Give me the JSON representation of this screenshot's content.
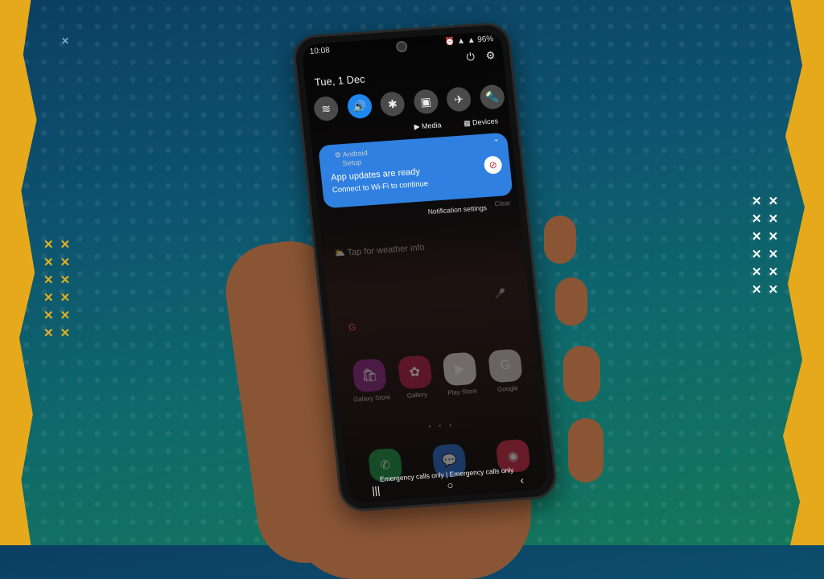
{
  "status_bar": {
    "time": "10:08",
    "icons": "⏰ ▲ ▲",
    "battery": "96%"
  },
  "header": {
    "date": "Tue, 1 Dec",
    "power_icon": "power-icon",
    "settings_icon": "gear-icon"
  },
  "quick_tiles": [
    {
      "name": "wifi",
      "icon": "wifi-icon",
      "glyph": "≋",
      "active": false
    },
    {
      "name": "sound",
      "icon": "volume-icon",
      "glyph": "🔊",
      "active": true
    },
    {
      "name": "bluetooth",
      "icon": "bluetooth-icon",
      "glyph": "✱",
      "active": false
    },
    {
      "name": "portrait",
      "icon": "rotation-lock-icon",
      "glyph": "▣",
      "active": false
    },
    {
      "name": "airplane",
      "icon": "airplane-icon",
      "glyph": "✈",
      "active": false
    },
    {
      "name": "flashlight",
      "icon": "flashlight-icon",
      "glyph": "🔦",
      "active": false
    }
  ],
  "media_label": "Media",
  "devices_label": "Devices",
  "notification": {
    "app": "Android Setup",
    "title": "App updates are ready",
    "text": "Connect to Wi-Fi to continue",
    "color": "#2f80e0"
  },
  "notification_settings": "Notification settings",
  "clear": "Clear",
  "home": {
    "weather": "Tap for weather info",
    "apps": [
      {
        "label": "Galaxy Store",
        "color": "#8a2a8a",
        "glyph": "🛍"
      },
      {
        "label": "Gallery",
        "color": "#b0204a",
        "glyph": "✿"
      },
      {
        "label": "Play Store",
        "color": "#dddddd",
        "glyph": "▶"
      },
      {
        "label": "Google",
        "color": "#cccccc",
        "glyph": "G"
      }
    ],
    "dock": [
      {
        "name": "phone",
        "color": "#1f9a4a",
        "glyph": "✆"
      },
      {
        "name": "messages",
        "color": "#2a6fd0",
        "glyph": "💬"
      },
      {
        "name": "camera",
        "color": "#d0304a",
        "glyph": "◉"
      }
    ]
  },
  "emergency": "Emergency calls only | Emergency calls only",
  "nav": {
    "recents": "|||",
    "home": "○",
    "back": "‹"
  }
}
